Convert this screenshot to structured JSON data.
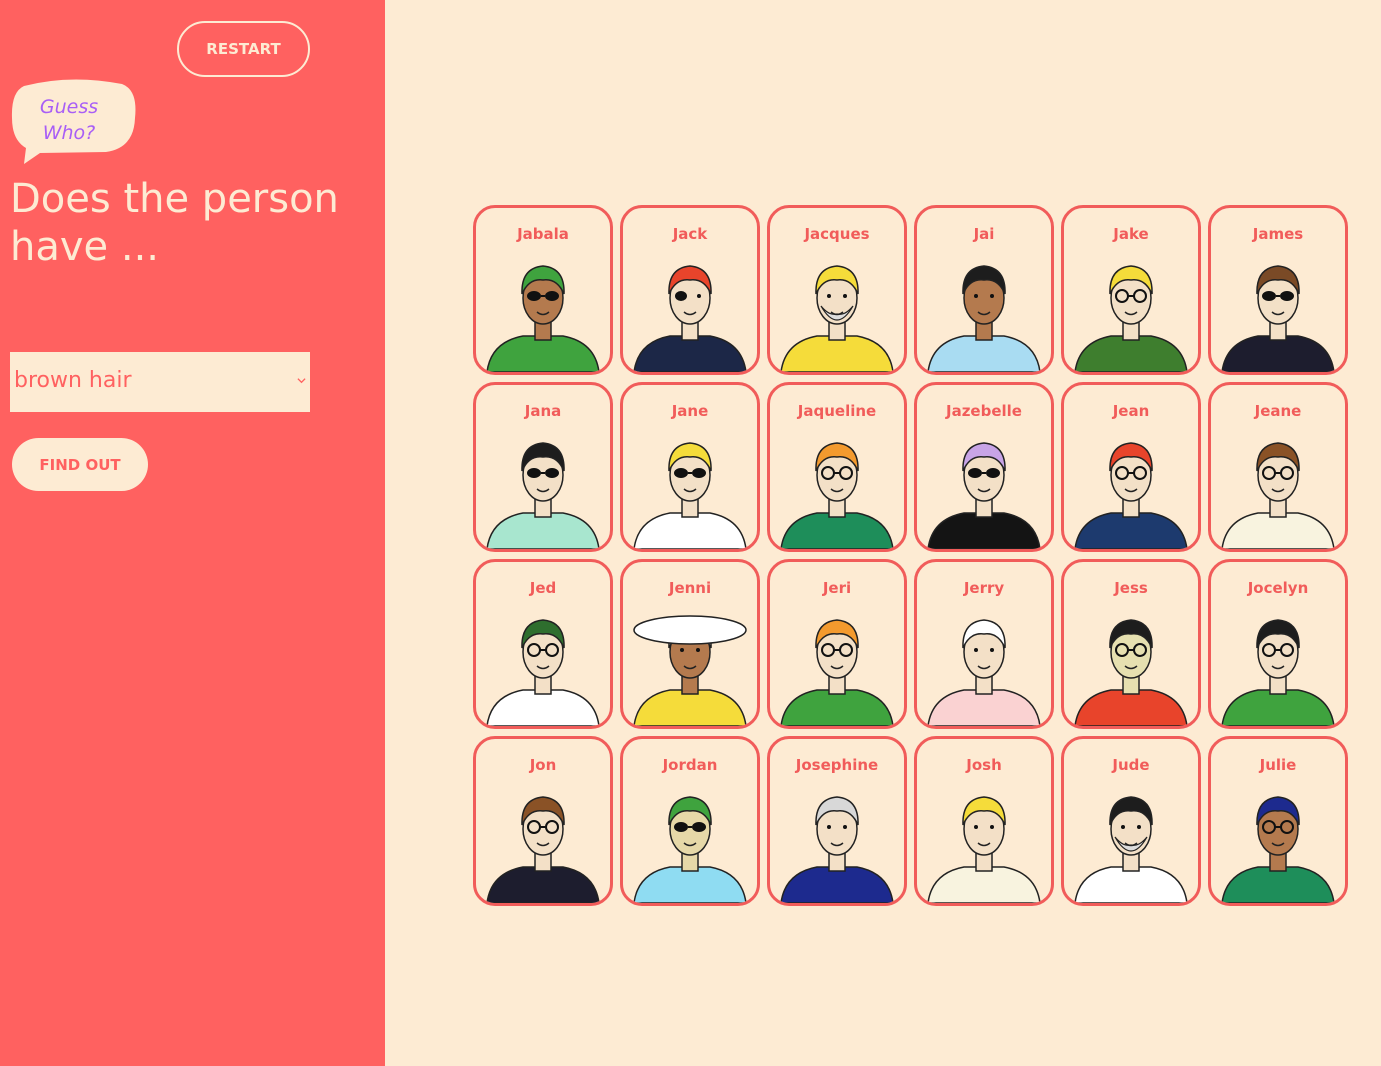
{
  "sidebar": {
    "restart_label": "RESTART",
    "logo_text": "Guess\nWho?",
    "question": "Does the person have ...",
    "selected_option": "brown hair",
    "find_out_label": "FIND OUT"
  },
  "colors": {
    "sidebar_bg": "#ff6160",
    "page_bg": "#fdebd3",
    "card_border": "#f15c5a",
    "logo_text": "#a85ef6"
  },
  "characters": [
    {
      "name": "Jabala",
      "shirt": "#3fa33e",
      "hair": "#3fa33e",
      "skin": "#b47a4e",
      "accessory": "sunglasses"
    },
    {
      "name": "Jack",
      "shirt": "#1c2747",
      "hair": "#e8442b",
      "skin": "#f3e0c7",
      "accessory": "eyepatch"
    },
    {
      "name": "Jacques",
      "shirt": "#f5dc3a",
      "hair": "#f5dc3a",
      "skin": "#f3e0c7",
      "accessory": "beard"
    },
    {
      "name": "Jai",
      "shirt": "#a9dcf2",
      "hair": "#1d1d1d",
      "skin": "#b47a4e",
      "accessory": "none"
    },
    {
      "name": "Jake",
      "shirt": "#3e7e2e",
      "hair": "#f5dc3a",
      "skin": "#f3e0c7",
      "accessory": "glasses"
    },
    {
      "name": "James",
      "shirt": "#1d1d2e",
      "hair": "#7a4a26",
      "skin": "#f3e0c7",
      "accessory": "sunglasses"
    },
    {
      "name": "Jana",
      "shirt": "#a8e6cf",
      "hair": "#1d1d1d",
      "skin": "#f3e0c7",
      "accessory": "sunglasses"
    },
    {
      "name": "Jane",
      "shirt": "#ffffff",
      "hair": "#f5dc3a",
      "skin": "#f3e0c7",
      "accessory": "sunglasses"
    },
    {
      "name": "Jaqueline",
      "shirt": "#1e8e5a",
      "hair": "#f39a2e",
      "skin": "#f3e0c7",
      "accessory": "glasses"
    },
    {
      "name": "Jazebelle",
      "shirt": "#141414",
      "hair": "#c8a4e6",
      "skin": "#f3e0c7",
      "accessory": "sunglasses"
    },
    {
      "name": "Jean",
      "shirt": "#1d3a6e",
      "hair": "#e8442b",
      "skin": "#f3e0c7",
      "accessory": "glasses"
    },
    {
      "name": "Jeane",
      "shirt": "#f8f3df",
      "hair": "#8a5226",
      "skin": "#f3e0c7",
      "accessory": "glasses"
    },
    {
      "name": "Jed",
      "shirt": "#ffffff",
      "hair": "#2e6e2e",
      "skin": "#f3e0c7",
      "accessory": "glasses"
    },
    {
      "name": "Jenni",
      "shirt": "#f5dc3a",
      "hair": "#ffffff",
      "skin": "#b47a4e",
      "accessory": "hat"
    },
    {
      "name": "Jeri",
      "shirt": "#3fa33e",
      "hair": "#f39a2e",
      "skin": "#f3e0c7",
      "accessory": "glasses"
    },
    {
      "name": "Jerry",
      "shirt": "#fad2d2",
      "hair": "#ffffff",
      "skin": "#f3e0c7",
      "accessory": "none"
    },
    {
      "name": "Jess",
      "shirt": "#e8442b",
      "hair": "#1d1d1d",
      "skin": "#e6e0b0",
      "accessory": "glasses"
    },
    {
      "name": "Jocelyn",
      "shirt": "#3fa33e",
      "hair": "#1d1d1d",
      "skin": "#f3e0c7",
      "accessory": "glasses"
    },
    {
      "name": "Jon",
      "shirt": "#1d1d2e",
      "hair": "#8a5226",
      "skin": "#f3e0c7",
      "accessory": "glasses"
    },
    {
      "name": "Jordan",
      "shirt": "#8fdcf2",
      "hair": "#3fa33e",
      "skin": "#e6d8a8",
      "accessory": "sunglasses"
    },
    {
      "name": "Josephine",
      "shirt": "#1d2a8e",
      "hair": "#d8d8d8",
      "skin": "#f3e0c7",
      "accessory": "none"
    },
    {
      "name": "Josh",
      "shirt": "#f8f3df",
      "hair": "#f5dc3a",
      "skin": "#f3e0c7",
      "accessory": "none"
    },
    {
      "name": "Jude",
      "shirt": "#ffffff",
      "hair": "#1d1d1d",
      "skin": "#f3e0c7",
      "accessory": "beard"
    },
    {
      "name": "Julie",
      "shirt": "#1e8e5a",
      "hair": "#1d2a8e",
      "skin": "#b47a4e",
      "accessory": "glasses"
    }
  ]
}
